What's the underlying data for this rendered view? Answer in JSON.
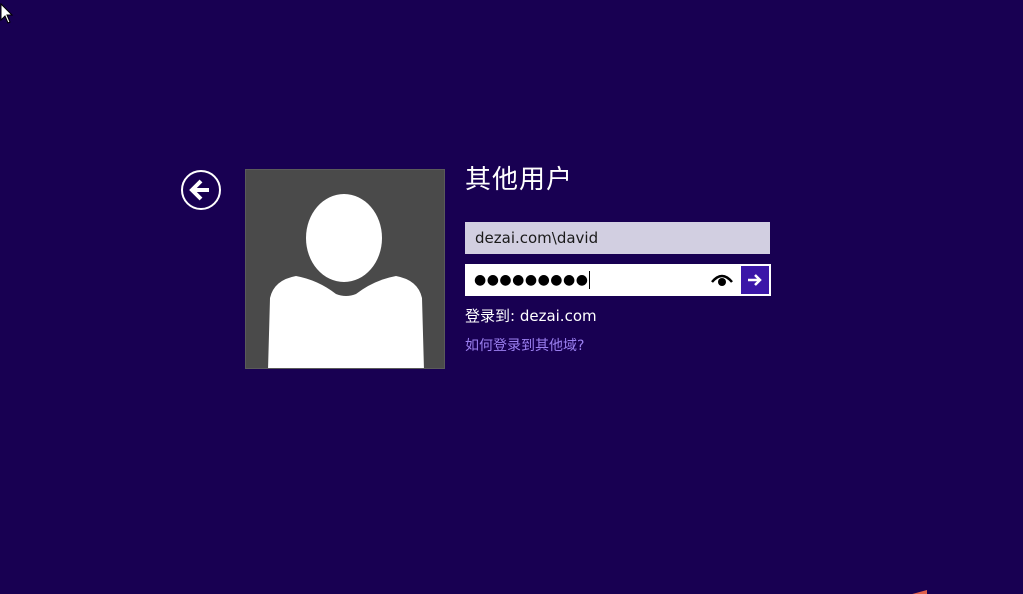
{
  "login": {
    "title": "其他用户",
    "username_value": "dezai.com\\david",
    "password_masked": "●●●●●●●●●",
    "signin_to": "登录到: dezai.com",
    "help_link": "如何登录到其他域?"
  },
  "icons": {
    "back": "back-arrow-circle-icon",
    "reveal": "eye-icon",
    "submit": "arrow-right-icon",
    "avatar": "default-user-silhouette-icon"
  },
  "colors": {
    "background": "#180052",
    "avatar_bg": "#4a4a4a",
    "username_field_bg": "#d2cfe1",
    "submit_bg": "#3b17a8",
    "link": "#9b7ff0"
  }
}
